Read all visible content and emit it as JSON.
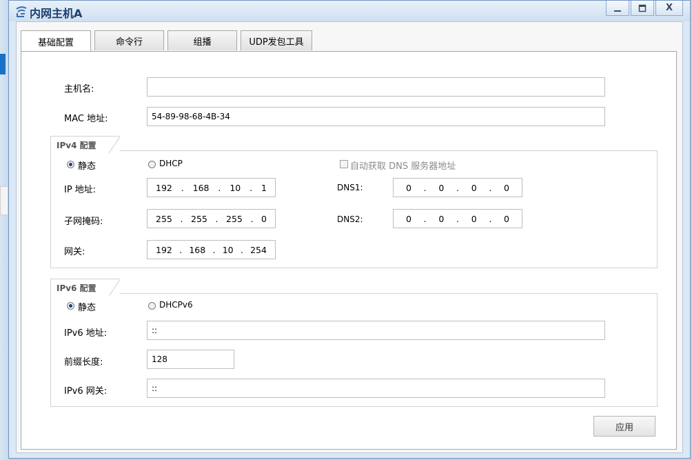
{
  "window": {
    "title": "内网主机A",
    "close_label": "X"
  },
  "tabs": [
    {
      "label": "基础配置"
    },
    {
      "label": "命令行"
    },
    {
      "label": "组播"
    },
    {
      "label": "UDP发包工具"
    }
  ],
  "basic": {
    "hostname_label": "主机名:",
    "hostname_value": "",
    "mac_label": "MAC 地址:",
    "mac_value": "54-89-98-68-4B-34"
  },
  "ipv4": {
    "section_title": "IPv4 配置",
    "static_label": "静态",
    "dhcp_label": "DHCP",
    "auto_dns_label": "自动获取 DNS 服务器地址",
    "ip_label": "IP 地址:",
    "ip": [
      "192",
      "168",
      "10",
      "1"
    ],
    "mask_label": "子网掩码:",
    "mask": [
      "255",
      "255",
      "255",
      "0"
    ],
    "gateway_label": "网关:",
    "gateway": [
      "192",
      "168",
      "10",
      "254"
    ],
    "dns1_label": "DNS1:",
    "dns1": [
      "0",
      "0",
      "0",
      "0"
    ],
    "dns2_label": "DNS2:",
    "dns2": [
      "0",
      "0",
      "0",
      "0"
    ],
    "selected_mode": "静态"
  },
  "ipv6": {
    "section_title": "IPv6 配置",
    "static_label": "静态",
    "dhcp_label": "DHCPv6",
    "addr_label": "IPv6 地址:",
    "addr_value": "::",
    "prefix_label": "前缀长度:",
    "prefix_value": "128",
    "gateway_label": "IPv6 网关:",
    "gateway_value": "::",
    "selected_mode": "静态"
  },
  "apply_label": "应用",
  "colors": {
    "title_text": "#1d3f6e",
    "window_frame": "#dbe8f5",
    "radio_dot": "#1e3e8a"
  }
}
